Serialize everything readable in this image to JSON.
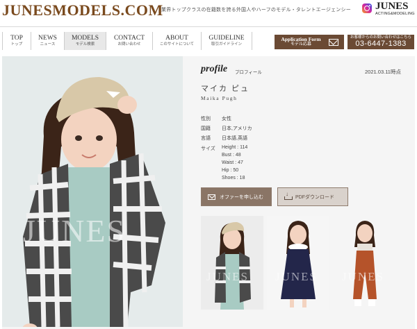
{
  "header": {
    "logo": "JUNESMODELS.COM",
    "tagline": "業界トップクラスの在籍数を誇る外国人やハーフのモデル・タレントエージェンシー",
    "brand_name": "JUNES",
    "brand_sub": "ACTING&MODELING",
    "instagram_icon": "instagram-icon"
  },
  "nav": {
    "items": [
      {
        "label": "TOP",
        "sub": "トップ",
        "active": false
      },
      {
        "label": "NEWS",
        "sub": "ニュース",
        "active": false
      },
      {
        "label": "MODELS",
        "sub": "モデル検索",
        "active": true
      },
      {
        "label": "CONTACT",
        "sub": "お問い合わせ",
        "active": false
      },
      {
        "label": "ABOUT",
        "sub": "このサイトについて",
        "active": false
      },
      {
        "label": "GUIDELINE",
        "sub": "取引ガイドライン",
        "active": false
      }
    ],
    "application": {
      "line1": "Application Form",
      "line2": "モデル応募",
      "icon": "mail-icon"
    },
    "phone": {
      "line1": "お客様からのお問い合わせはこちら",
      "number": "03-6447-1383"
    }
  },
  "profile": {
    "title": "profile",
    "title_jp": "プロフィール",
    "date": "2021.03.11時点",
    "name_jp": "マイカ ピュ",
    "name_en": "Maika Pugh",
    "info": [
      {
        "key": "性別",
        "value": "女性"
      },
      {
        "key": "国籍",
        "value": "日本,アメリカ"
      },
      {
        "key": "言語",
        "value": "日本語,英語"
      }
    ],
    "size_label": "サイズ",
    "measurements": [
      "Height : 114",
      "Bust : 48",
      "Waist : 47",
      "Hip : 50",
      "Shoes : 18"
    ],
    "offer_button": "オファーを申し込む",
    "pdf_button": "PDFダウンロード"
  },
  "photos": {
    "watermark": "JUNES",
    "thumbnails": [
      "thumb-plaid-shirt",
      "thumb-navy-dress",
      "thumb-orange-overalls"
    ]
  },
  "colors": {
    "logo_brown": "#7a4a1e",
    "cta_brown": "#6b4a34",
    "offer_button": "#8a7566",
    "pdf_button": "#d9d2cc"
  }
}
